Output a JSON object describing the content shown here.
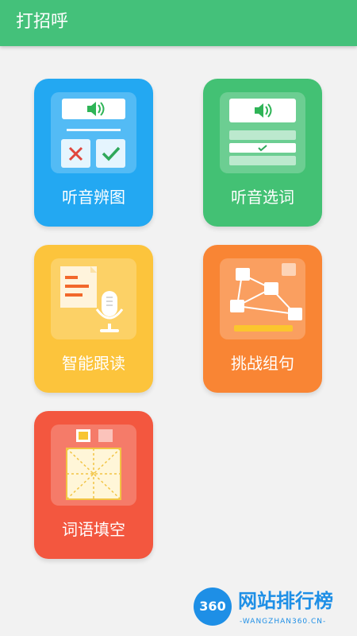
{
  "header": {
    "title": "打招呼"
  },
  "cards": [
    {
      "label": "听音辨图",
      "color": "#23a8f2",
      "icon": "listen-identify-picture-icon"
    },
    {
      "label": "听音选词",
      "color": "#43c174",
      "icon": "listen-choose-word-icon"
    },
    {
      "label": "智能跟读",
      "color": "#fcc43c",
      "icon": "smart-read-along-icon"
    },
    {
      "label": "挑战组句",
      "color": "#f98534",
      "icon": "challenge-sentence-building-icon"
    },
    {
      "label": "词语填空",
      "color": "#f3573f",
      "icon": "word-fill-in-icon"
    }
  ],
  "watermark": {
    "badge": "360",
    "title": "网站排行榜",
    "subtitle": "-WANGZHAN360.CN-"
  },
  "colors": {
    "header_bg": "#44c17a",
    "background": "#f2f2f2",
    "watermark": "#1e8fe6"
  }
}
